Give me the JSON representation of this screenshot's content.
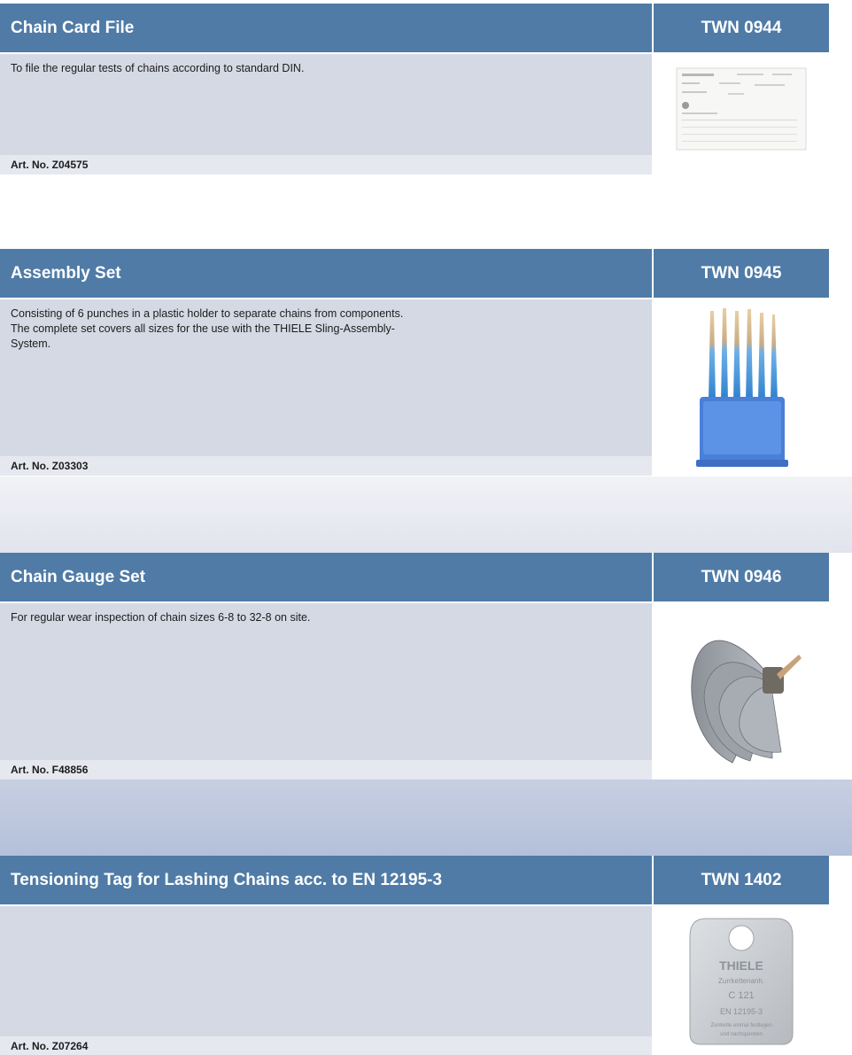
{
  "products": [
    {
      "title": "Chain Card File",
      "code": "TWN 0944",
      "description": [
        "To file the regular tests of chains according to standard DIN."
      ],
      "art_no": "Art. No. Z04575",
      "image": "chain-card-document"
    },
    {
      "title": "Assembly Set",
      "code": "TWN 0945",
      "description": [
        "Consisting of 6 punches in a plastic holder to separate chains from components.",
        "The complete set covers all sizes for the use with the THIELE Sling-Assembly-",
        "System."
      ],
      "art_no": "Art. No. Z03303",
      "image": "punch-set-blue-holder"
    },
    {
      "title": "Chain Gauge Set",
      "code": "TWN 0946",
      "description": [
        "For regular wear inspection of chain sizes 6-8 to 32-8 on site."
      ],
      "art_no": "Art. No. F48856",
      "image": "fan-gauge-set"
    },
    {
      "title": "Tensioning Tag for Lashing Chains acc. to EN 12195-3",
      "code": "TWN 1402",
      "description": [],
      "art_no": "Art. No. Z07264",
      "image": "metal-tag",
      "tag_text": {
        "brand": "THIELE",
        "subtitle": "Zurrkettenanh.",
        "model": "C 121",
        "standard": "EN 12195-3",
        "line1": "Zurrkette einmal festlegen",
        "line2": "und nachspannen"
      }
    }
  ],
  "colors": {
    "header_blue": "#4f7ba6",
    "desc_bg": "#d5d9e4",
    "art_bg": "#e6e8ef",
    "punch_blue": "#3d8fd6",
    "holder_blue": "#4a7fd8"
  }
}
